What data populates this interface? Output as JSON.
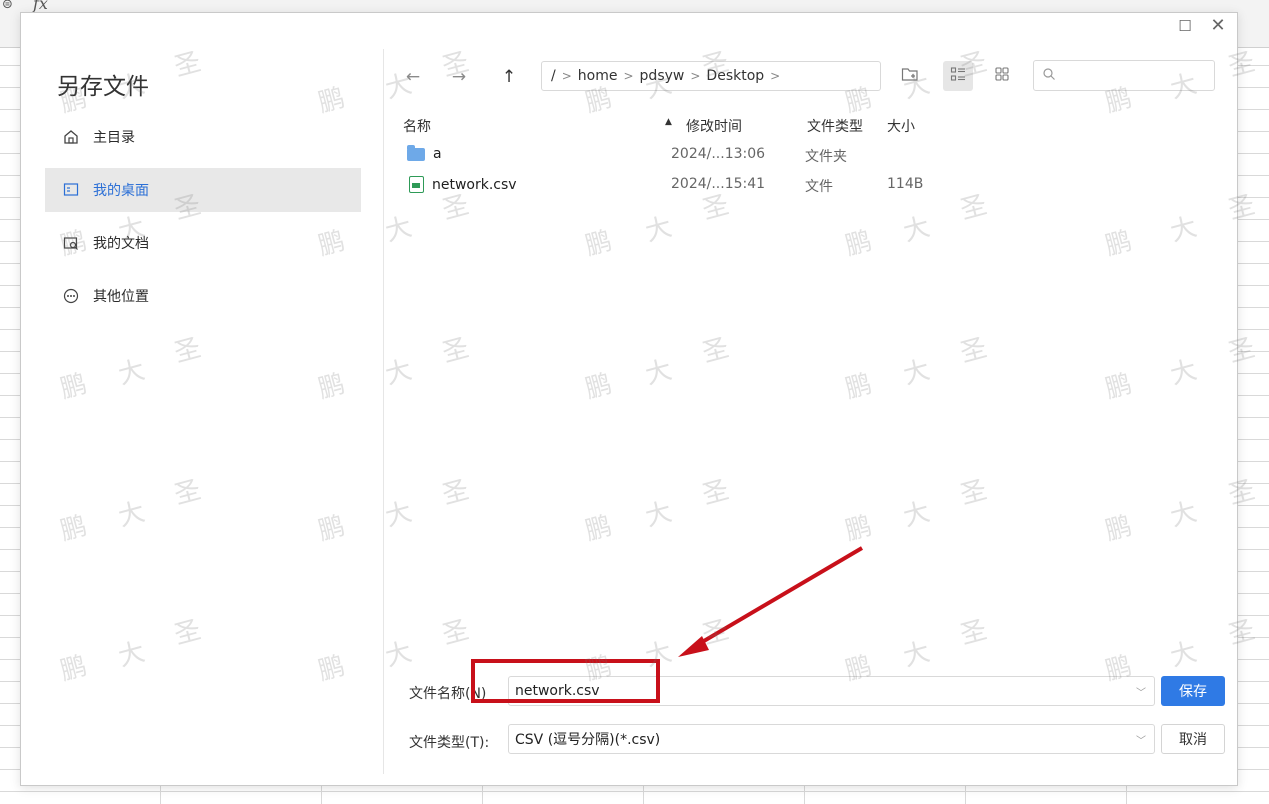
{
  "formula_bar": {
    "fx_label": "fx",
    "zoom_glyph": "⊜"
  },
  "dialog": {
    "title": "另存文件",
    "window_controls": {
      "maximize": "☐",
      "close": "✕"
    },
    "sidebar": [
      {
        "label": "主目录",
        "icon": "home-icon",
        "active": false
      },
      {
        "label": "我的桌面",
        "icon": "desktop-icon",
        "active": true
      },
      {
        "label": "我的文档",
        "icon": "documents-icon",
        "active": false
      },
      {
        "label": "其他位置",
        "icon": "more-locations-icon",
        "active": false
      }
    ],
    "toolbar": {
      "back": "←",
      "forward": "→",
      "up": "↑",
      "breadcrumb": [
        "/",
        "home",
        "pdsyw",
        "Desktop"
      ],
      "breadcrumb_sep": ">"
    },
    "columns": {
      "name": "名称",
      "modified": "修改时间",
      "type": "文件类型",
      "size": "大小",
      "sort_indicator": "▲"
    },
    "files": [
      {
        "name": "a",
        "icon": "folder-icon",
        "modified": "2024/...13:06",
        "type": "文件夹",
        "size": ""
      },
      {
        "name": "network.csv",
        "icon": "csv-file-icon",
        "modified": "2024/...15:41",
        "type": "文件",
        "size": "114B"
      }
    ],
    "form": {
      "filename_label": "文件名称(N)",
      "filename_value": "network.csv",
      "filetype_label": "文件类型(T):",
      "filetype_value": "CSV (逗号分隔)(*.csv)",
      "save_button": "保存",
      "cancel_button": "取消"
    }
  },
  "watermark": {
    "chars": [
      "鹏",
      "大",
      "圣"
    ],
    "color": "#9a9a9a"
  },
  "annotation": {
    "highlight_color": "#c8101a"
  }
}
